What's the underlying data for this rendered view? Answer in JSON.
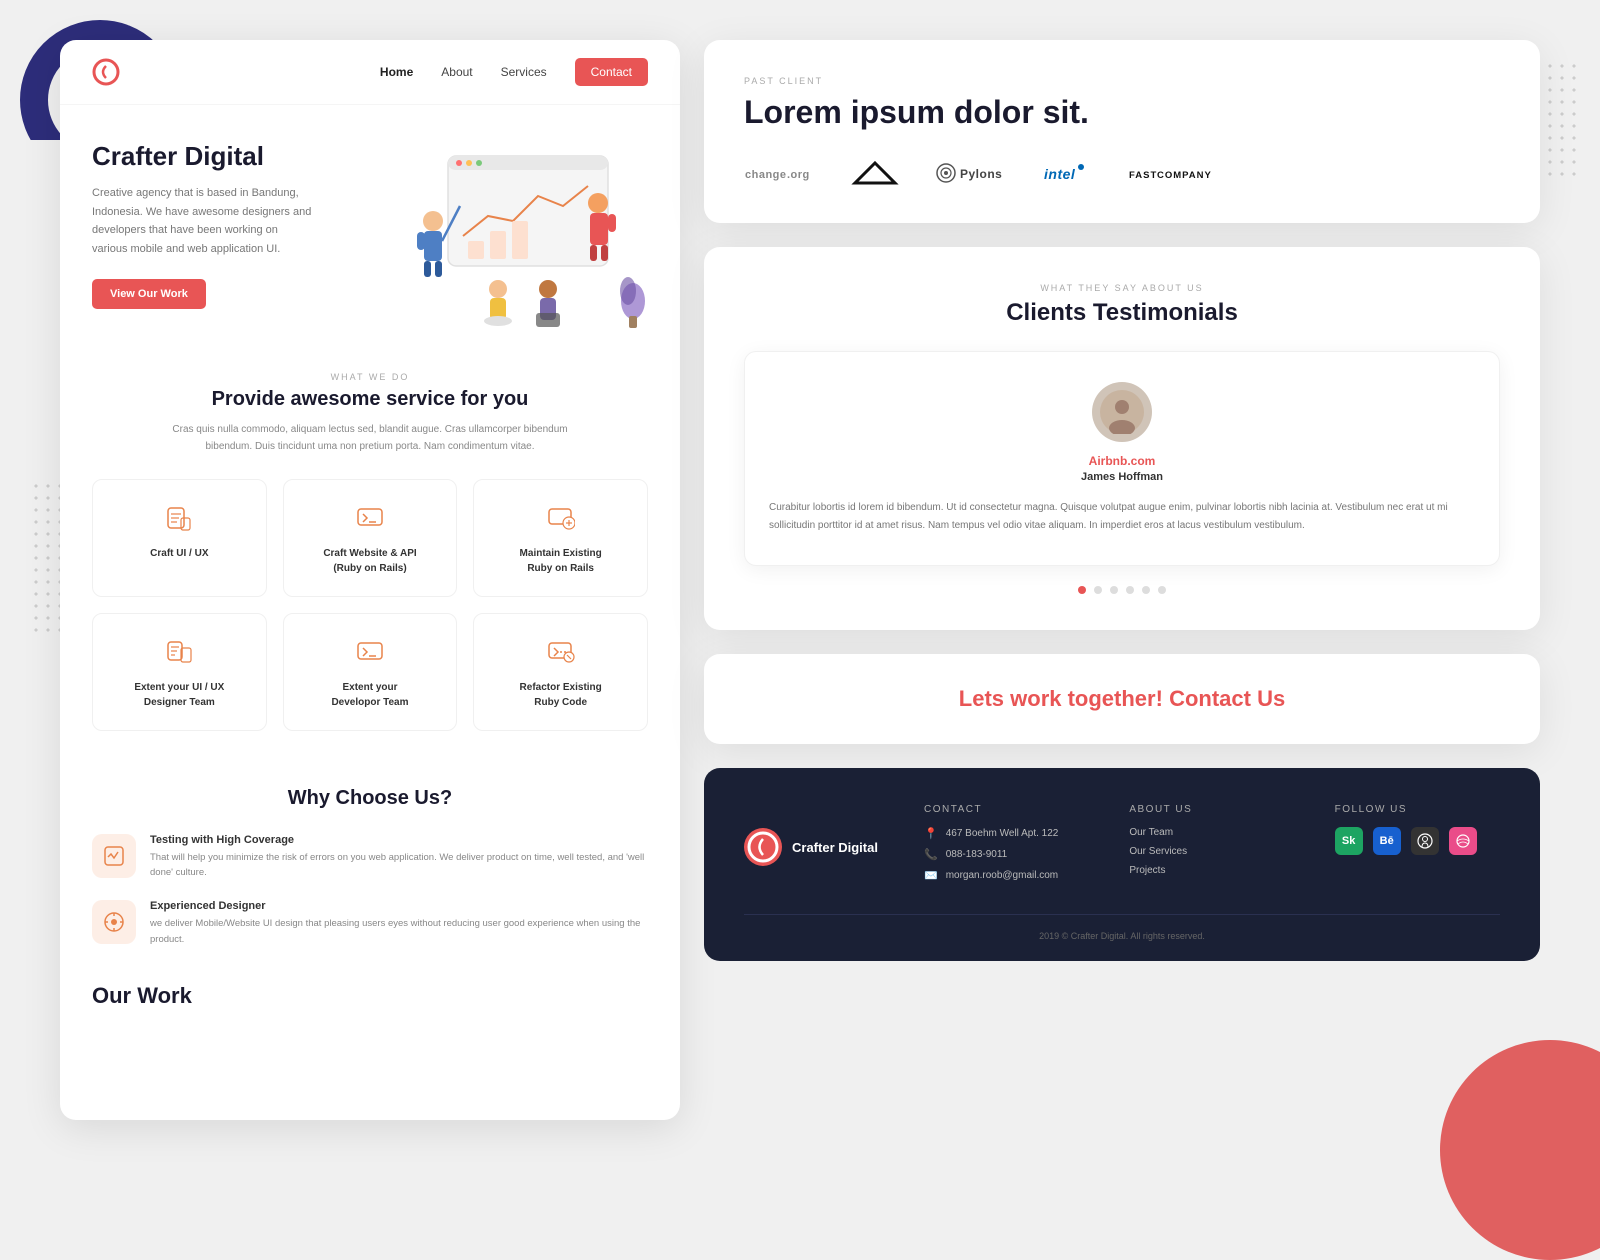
{
  "background": {
    "bg_color": "#f0f0f0"
  },
  "left_panel": {
    "nav": {
      "logo_text": "C",
      "links": [
        {
          "label": "Home",
          "active": true
        },
        {
          "label": "About",
          "active": false
        },
        {
          "label": "Services",
          "active": false
        }
      ],
      "cta_label": "Contact"
    },
    "hero": {
      "title": "Crafter Digital",
      "description": "Creative agency that is based in Bandung, Indonesia. We have awesome designers and developers that have been working on various mobile and web application UI.",
      "cta_label": "View Our Work"
    },
    "what_we_do": {
      "label": "WHAT WE DO",
      "title": "Provide awesome service for you",
      "description": "Cras quis nulla commodo, aliquam lectus sed, blandit augue. Cras ullamcorper bibendum bibendum. Duis tincidunt uma non pretium porta. Nam condimentum vitae."
    },
    "services": [
      {
        "name": "Craft UI / UX",
        "icon": "📱"
      },
      {
        "name": "Craft Website & API\n(Ruby on Rails)",
        "icon": "💻"
      },
      {
        "name": "Maintain Existing\nRuby on Rails",
        "icon": "⚙️"
      },
      {
        "name": "Extent your UI / UX\nDesigner Team",
        "icon": "📄"
      },
      {
        "name": "Extent your\nDevelopor Team",
        "icon": "💻"
      },
      {
        "name": "Refactor Existing\nRuby Code",
        "icon": "🔧"
      }
    ],
    "why_choose_us": {
      "title": "Why Choose Us?",
      "items": [
        {
          "title": "Testing with High Coverage",
          "description": "That will help you minimize the risk of errors on you web application. We deliver product on time, well tested, and 'well done' culture.",
          "icon": "📊"
        },
        {
          "title": "Experienced Designer",
          "description": "we deliver Mobile/Website UI design that pleasing users eyes without reducing user good experience when using the product.",
          "icon": "🎨"
        }
      ]
    },
    "our_work": {
      "title": "Our Work"
    }
  },
  "right_panel": {
    "past_client": {
      "label": "PAST CLIENT",
      "title": "Lorem ipsum dolor sit.",
      "logos": [
        {
          "name": "change.org",
          "symbol": "c",
          "display": "change..."
        },
        {
          "name": "adidas",
          "display": "adidas"
        },
        {
          "name": "pylons",
          "display": "Pylons"
        },
        {
          "name": "intel",
          "display": "intel"
        },
        {
          "name": "fastcompany",
          "display": "FAST COMPANY"
        }
      ]
    },
    "testimonials": {
      "label": "WHAT THEY SAY ABOUT US",
      "title": "Clients Testimonials",
      "items": [
        {
          "company": "Airbnb.com",
          "author": "James Hoffman",
          "text": "Curabitur lobortis id lorem id bibendum. Ut id consectetur magna. Quisque volutpat augue enim, pulvinar lobortis nibh lacinia at. Vestibulum nec erat ut mi sollicitudin porttitor id at amet risus. Nam tempus vel odio vitae aliquam. In imperdiet eros at lacus vestibulum vestibulum.",
          "avatar": "👤"
        }
      ],
      "dots": [
        true,
        false,
        false,
        false,
        false,
        false
      ]
    },
    "cta": {
      "text": "Lets work together!",
      "link_label": "Contact Us"
    },
    "footer": {
      "brand_name": "Crafter Digital",
      "columns": [
        {
          "title": "CONTACT",
          "items": [
            {
              "icon": "📍",
              "text": "467 Boehm Well Apt. 122"
            },
            {
              "icon": "📞",
              "text": "088-183-9011"
            },
            {
              "icon": "✉️",
              "text": "morgan.roob@gmail.com"
            }
          ]
        },
        {
          "title": "ABOUT US",
          "items": [
            "Our Team",
            "Our Services",
            "Projects"
          ]
        },
        {
          "title": "FOLLOW US",
          "socials": [
            {
              "icon": "🟩",
              "label": "behance-icon",
              "bg": "#1da462"
            },
            {
              "icon": "Bē",
              "label": "behance-icon",
              "bg": "#1760cf"
            },
            {
              "icon": "◯",
              "label": "github-icon",
              "bg": "#333"
            },
            {
              "icon": "🌸",
              "label": "dribbble-icon",
              "bg": "#ea4c89"
            }
          ]
        }
      ],
      "copyright": "2019 © Crafter Digital. All rights reserved."
    }
  }
}
